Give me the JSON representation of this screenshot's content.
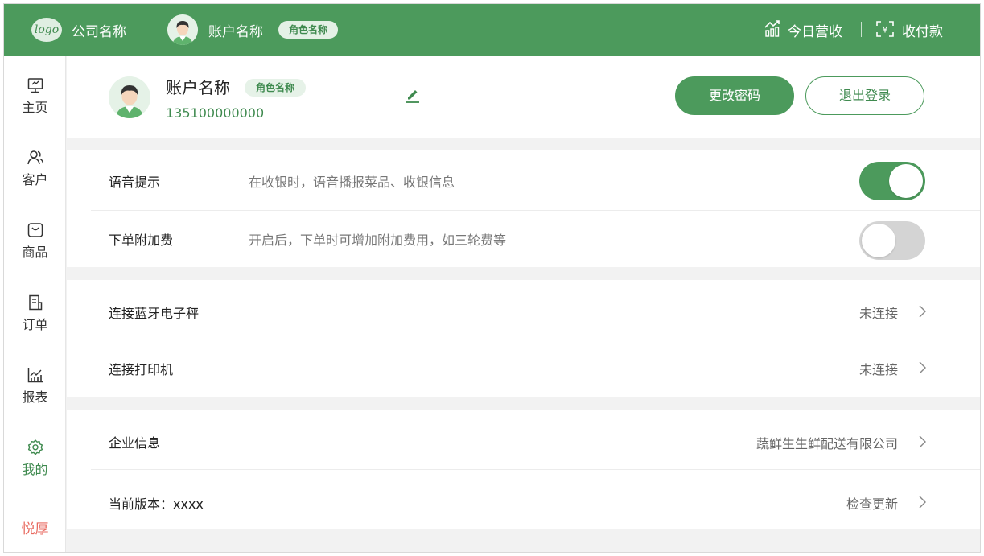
{
  "header": {
    "logo_text": "logo",
    "company_name": "公司名称",
    "account_name": "账户名称",
    "role_badge": "角色名称",
    "revenue_label": "今日营收",
    "payment_label": "收付款"
  },
  "sidebar": {
    "items": [
      {
        "label": "主页",
        "icon": "monitor-icon",
        "active": false
      },
      {
        "label": "客户",
        "icon": "customers-icon",
        "active": false
      },
      {
        "label": "商品",
        "icon": "bag-icon",
        "active": false
      },
      {
        "label": "订单",
        "icon": "receipt-icon",
        "active": false
      },
      {
        "label": "报表",
        "icon": "chart-icon",
        "active": false
      },
      {
        "label": "我的",
        "icon": "gear-icon",
        "active": true
      }
    ],
    "brand": "悦厚"
  },
  "profile": {
    "name": "账户名称",
    "role": "角色名称",
    "phone": "135100000000",
    "change_password_label": "更改密码",
    "logout_label": "退出登录"
  },
  "settings": {
    "voice": {
      "label": "语音提示",
      "desc": "在收银时，语音播报菜品、收银信息",
      "enabled": true
    },
    "surcharge": {
      "label": "下单附加费",
      "desc": "开启后，下单时可增加附加费用，如三轮费等",
      "enabled": false
    },
    "scale": {
      "label": "连接蓝牙电子秤",
      "value": "未连接"
    },
    "printer": {
      "label": "连接打印机",
      "value": "未连接"
    },
    "company_info": {
      "label": "企业信息",
      "value": "蔬鲜生生鲜配送有限公司"
    },
    "version": {
      "label": "当前版本：xxxx",
      "value": "检查更新"
    }
  },
  "colors": {
    "primary": "#4c9a5c",
    "brand_text": "#e86a60"
  }
}
